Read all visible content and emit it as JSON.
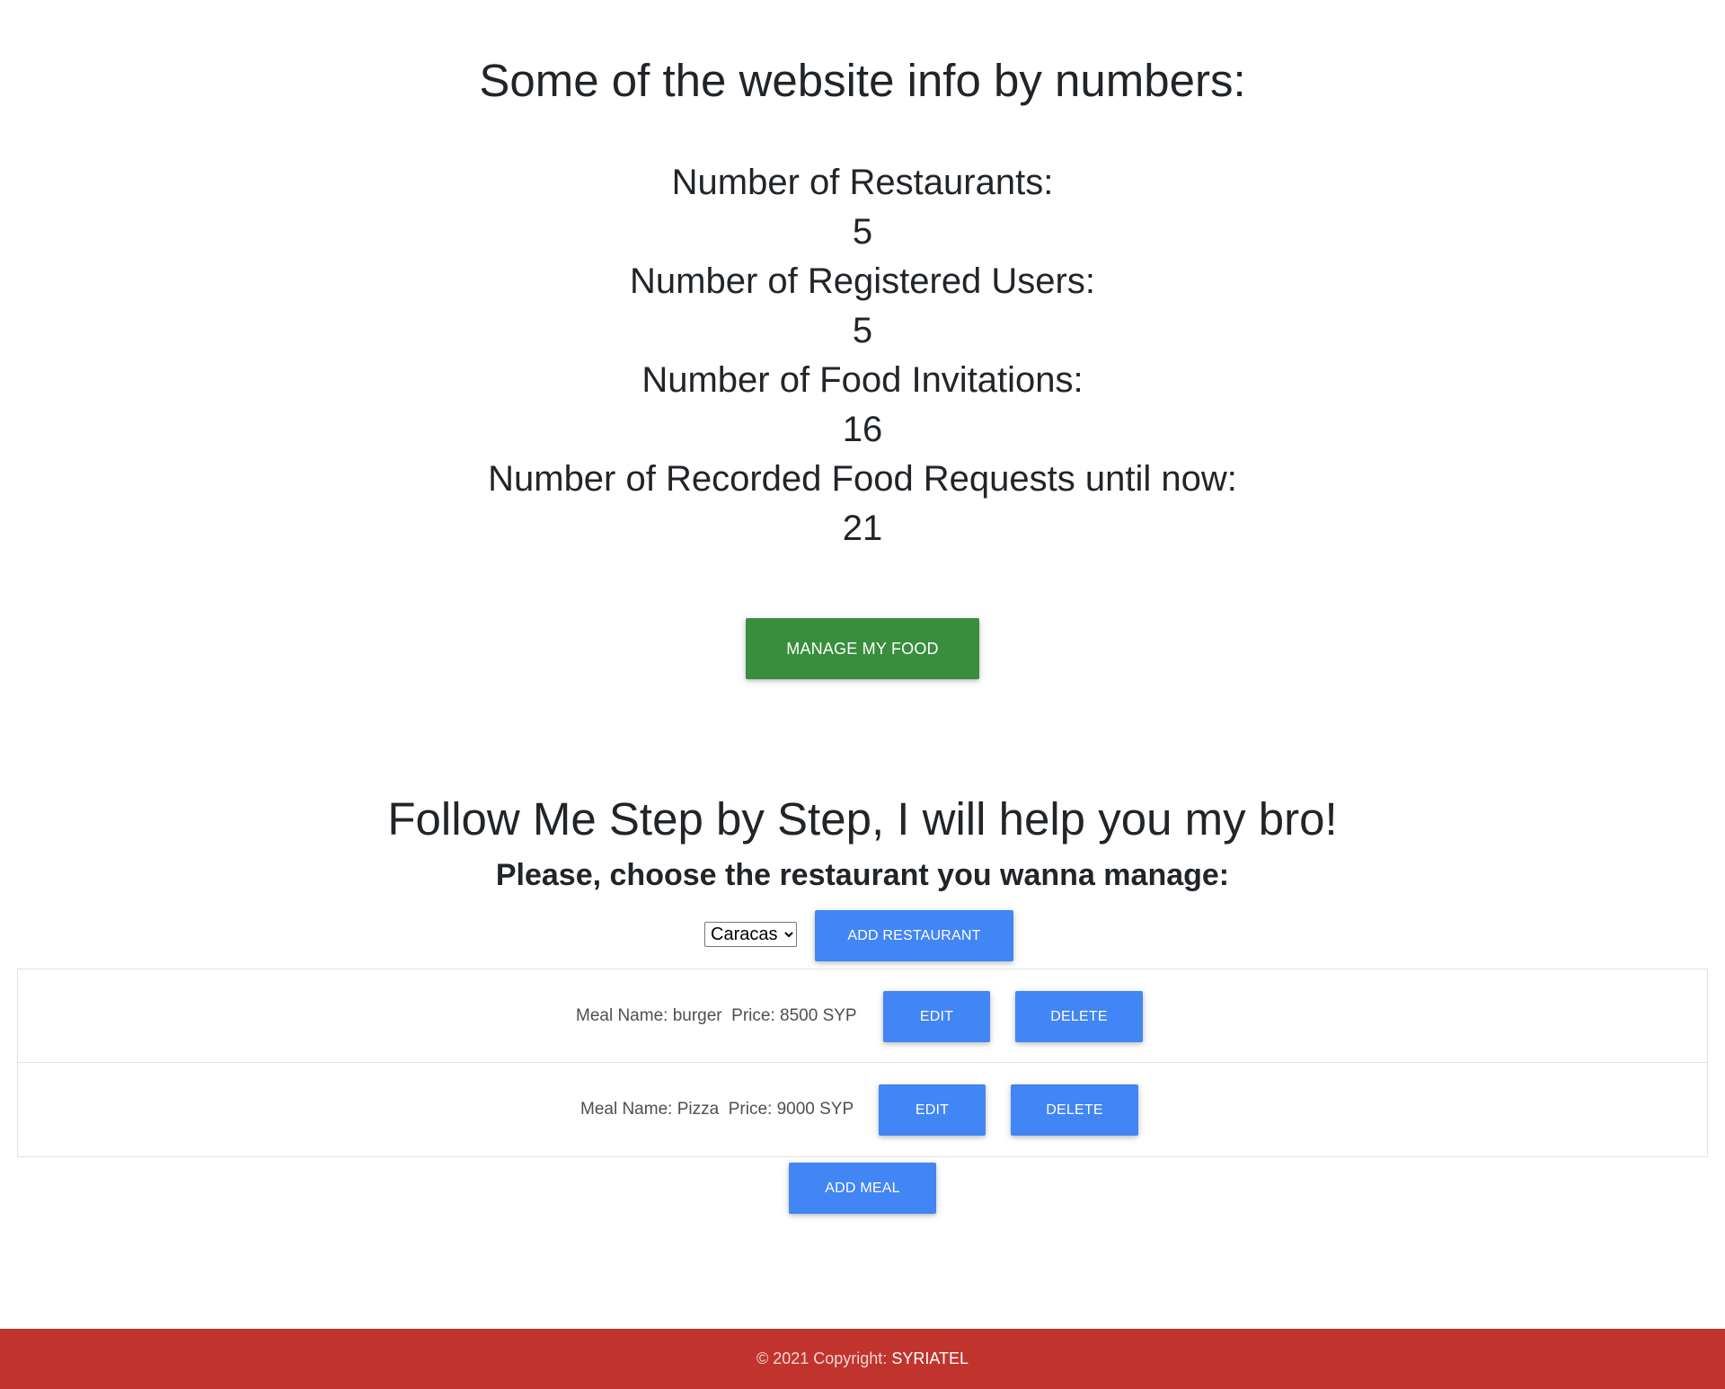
{
  "stats": {
    "title": "Some of the website info by numbers:",
    "restaurants_label": "Number of Restaurants:",
    "restaurants_value": "5",
    "users_label": "Number of Registered Users:",
    "users_value": "5",
    "invitations_label": "Number of Food Invitations:",
    "invitations_value": "16",
    "requests_label": "Number of Recorded Food Requests until now:",
    "requests_value": "21"
  },
  "manage_button": "MANAGE MY FOOD",
  "manager": {
    "title": "Follow Me Step by Step, I will help you my bro!",
    "choose_label": "Please, choose the restaurant you wanna manage:",
    "selected_restaurant": "Caracas",
    "add_restaurant_label": "ADD RESTAURANT",
    "add_meal_label": "ADD MEAL"
  },
  "meals": [
    {
      "text": "Meal Name: burger  Price: 8500 SYP",
      "edit_label": "EDIT",
      "delete_label": "DELETE"
    },
    {
      "text": "Meal Name: Pizza  Price: 9000 SYP",
      "edit_label": "EDIT",
      "delete_label": "DELETE"
    }
  ],
  "footer": {
    "copyright": "© 2021 Copyright: ",
    "brand": "SYRIATEL"
  },
  "colors": {
    "green_button": "#388e3c",
    "blue_button": "#4285f4",
    "footer_bg": "#c1342e"
  }
}
